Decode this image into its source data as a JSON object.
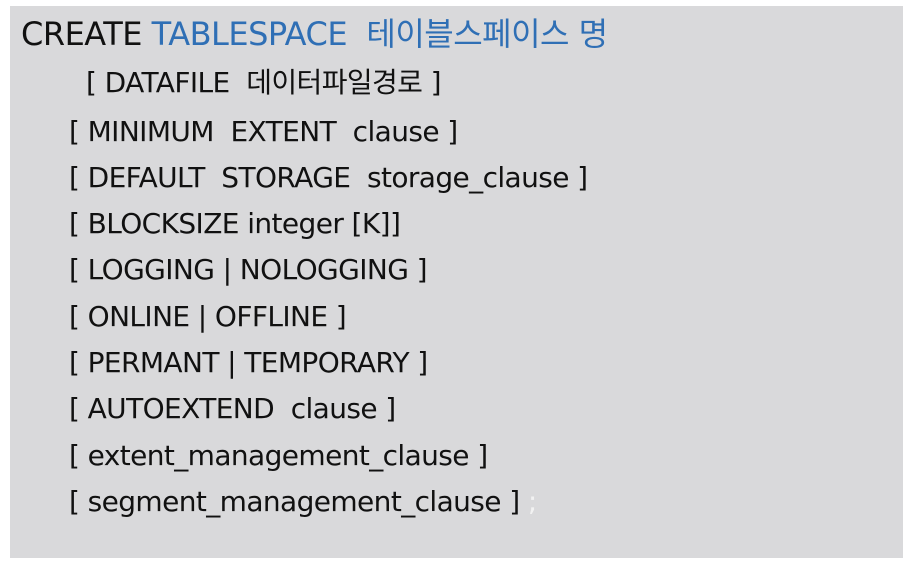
{
  "syntax": {
    "keyword": "CREATE",
    "object": "TABLESPACE",
    "name": "테이블스페이스 명",
    "clauses": [
      "[ DATAFILE  데이터파일경로 ]",
      "[ MINIMUM  EXTENT  clause ]",
      "[ DEFAULT  STORAGE  storage_clause ]",
      "[ BLOCKSIZE integer [K]]",
      "[ LOGGING | NOLOGGING ]",
      "[ ONLINE | OFFLINE ]",
      "[ PERMANT | TEMPORARY ]",
      "[ AUTOEXTEND  clause ]",
      "[ extent_management_clause ]",
      "[ segment_management_clause ]"
    ],
    "terminator": " ;"
  },
  "colors": {
    "panel_background": "#d9d9db",
    "text": "#111111",
    "highlight": "#2f6fb5",
    "terminator": "#f2f2f2"
  }
}
